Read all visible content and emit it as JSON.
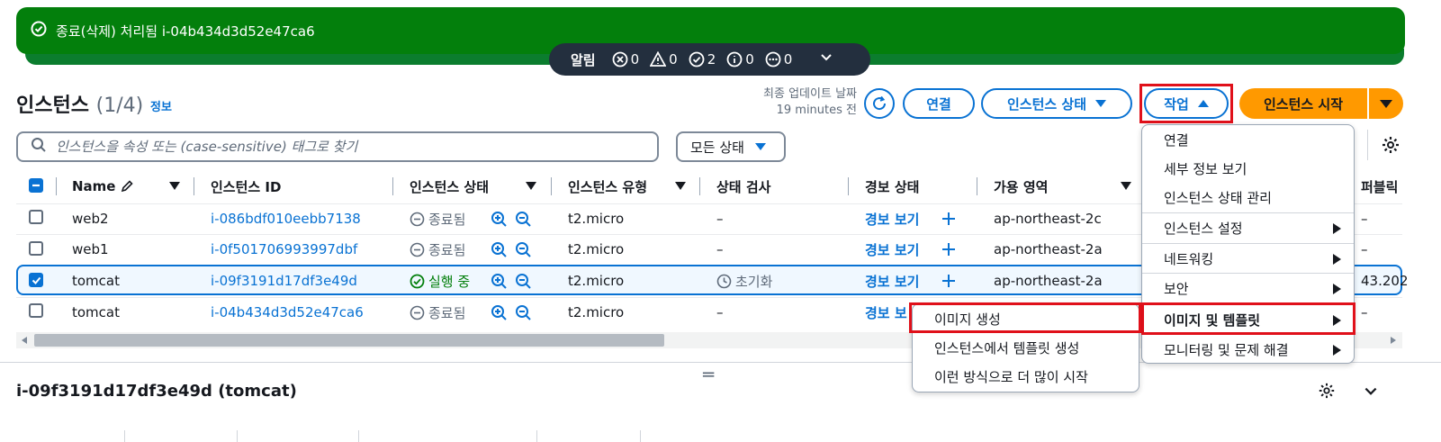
{
  "flash": {
    "message": "종료(삭제) 처리됨 i-04b434d3d52e47ca6",
    "bg_color": "#037f0c"
  },
  "notifications": {
    "label": "알림",
    "error_count": "0",
    "warning_count": "0",
    "success_count": "2",
    "info_count": "0",
    "pending_count": "0"
  },
  "header": {
    "title": "인스턴스",
    "count": "(1/4)",
    "info_link": "정보",
    "last_updated_label": "최종 업데이트 날짜",
    "last_updated_value": "19 minutes 전",
    "connect_label": "연결",
    "instance_state_label": "인스턴스 상태",
    "actions_label": "작업",
    "launch_label": "인스턴스 시작",
    "launch_color": "#ff9900"
  },
  "search": {
    "placeholder": "인스턴스을 속성 또는 (case-sensitive) 태그로 찾기",
    "value": ""
  },
  "filter": {
    "selected": "모든 상태"
  },
  "table": {
    "columns": [
      "Name",
      "인스턴스 ID",
      "인스턴스 상태",
      "인스턴스 유형",
      "상태 검사",
      "경보 상태",
      "가용 영역",
      "퍼블릭"
    ],
    "rows": [
      {
        "name": "web2",
        "id": "i-086bdf010eebb7138",
        "state": "종료됨",
        "type": "t2.micro",
        "check": "–",
        "alarm": "경보 보기",
        "az": "ap-northeast-2c",
        "public": "–",
        "selected": false
      },
      {
        "name": "web1",
        "id": "i-0f501706993997dbf",
        "state": "종료됨",
        "type": "t2.micro",
        "check": "–",
        "alarm": "경보 보기",
        "az": "ap-northeast-2a",
        "public": "–",
        "selected": false
      },
      {
        "name": "tomcat",
        "id": "i-09f3191d17df3e49d",
        "state": "실행 중",
        "type": "t2.micro",
        "check": "초기화",
        "alarm": "경보 보기",
        "az": "ap-northeast-2a",
        "public": "43.202",
        "selected": true
      },
      {
        "name": "tomcat",
        "id": "i-04b434d3d52e47ca6",
        "state": "종료됨",
        "type": "t2.micro",
        "check": "–",
        "alarm": "경보 보",
        "az": "",
        "public": "–",
        "selected": false
      }
    ]
  },
  "action_menu": {
    "items": [
      "연결",
      "세부 정보 보기",
      "인스턴스 상태 관리",
      "인스턴스 설정",
      "네트워킹",
      "보안",
      "이미지 및 템플릿",
      "모니터링 및 문제 해결"
    ]
  },
  "image_submenu": {
    "items": [
      "이미지 생성",
      "인스턴스에서 템플릿 생성",
      "이런 방식으로 더 많이 시작"
    ]
  },
  "detail": {
    "title": "i-09f3191d17df3e49d (tomcat)"
  },
  "colors": {
    "link": "#0972d3",
    "highlight": "#e0101a",
    "running": "#037f0c"
  }
}
